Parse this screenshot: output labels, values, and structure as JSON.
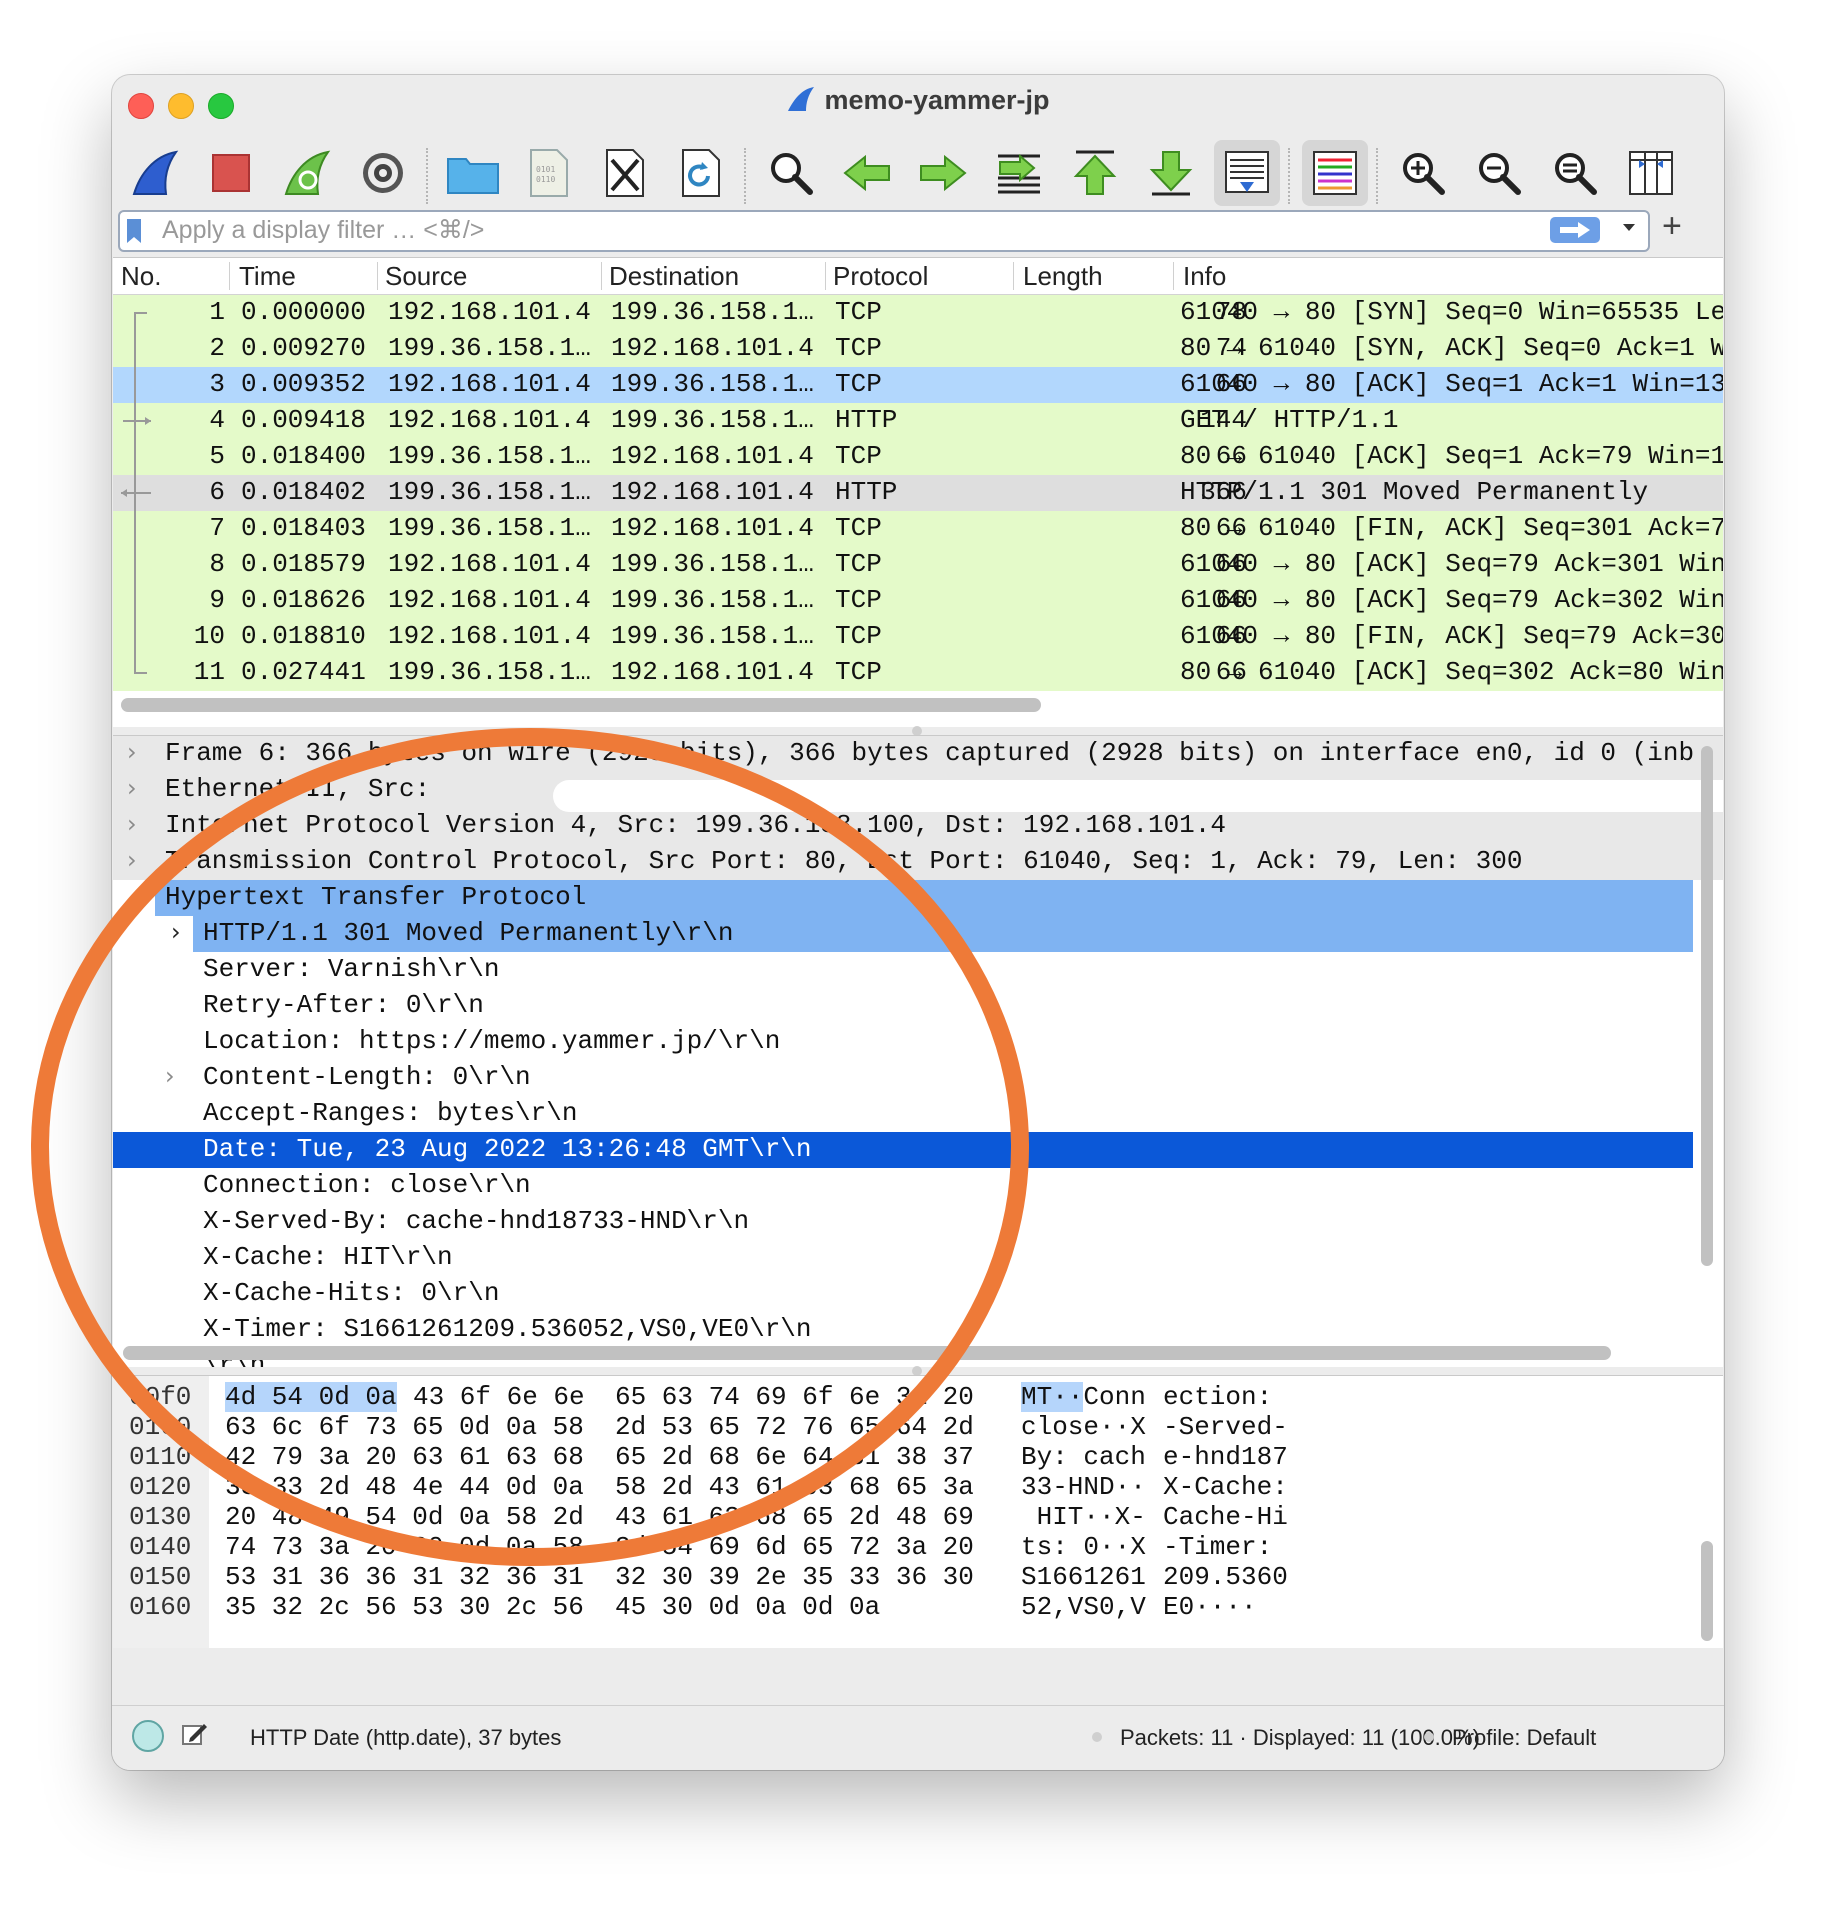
{
  "window": {
    "title": "memo-yammer-jp"
  },
  "toolbar": {
    "buttons": [
      {
        "name": "start-capture",
        "icon": "shark-fin-icon"
      },
      {
        "name": "stop-capture",
        "icon": "stop-icon"
      },
      {
        "name": "restart-capture",
        "icon": "restart-icon"
      },
      {
        "name": "capture-options",
        "icon": "gear-icon"
      },
      {
        "name": "open-file",
        "icon": "folder-icon"
      },
      {
        "name": "save-file",
        "icon": "file-icon"
      },
      {
        "name": "close-file",
        "icon": "close-file-icon"
      },
      {
        "name": "reload-file",
        "icon": "reload-icon"
      },
      {
        "name": "find-packet",
        "icon": "search-icon"
      },
      {
        "name": "go-back",
        "icon": "arrow-left-icon"
      },
      {
        "name": "go-forward",
        "icon": "arrow-right-icon"
      },
      {
        "name": "go-to-packet",
        "icon": "goto-icon"
      },
      {
        "name": "first-packet",
        "icon": "arrow-up-icon"
      },
      {
        "name": "last-packet",
        "icon": "arrow-down-icon"
      },
      {
        "name": "auto-scroll",
        "icon": "autoscroll-icon"
      },
      {
        "name": "colorize",
        "icon": "colorize-icon"
      },
      {
        "name": "zoom-in",
        "icon": "zoom-in-icon"
      },
      {
        "name": "zoom-out",
        "icon": "zoom-out-icon"
      },
      {
        "name": "normal-size",
        "icon": "zoom-reset-icon"
      },
      {
        "name": "resize-columns",
        "icon": "resize-columns-icon"
      }
    ]
  },
  "filter": {
    "placeholder": "Apply a display filter … <⌘/>",
    "add_label": "+"
  },
  "packet_list": {
    "columns": [
      "No.",
      "Time",
      "Source",
      "Destination",
      "Protocol",
      "Length",
      "Info"
    ],
    "rows": [
      {
        "no": "1",
        "time": "0.000000",
        "src": "192.168.101.4",
        "dst": "199.36.158.1…",
        "proto": "TCP",
        "len": "78",
        "info": "61040 → 80 [SYN] Seq=0 Win=65535 Le"
      },
      {
        "no": "2",
        "time": "0.009270",
        "src": "199.36.158.1…",
        "dst": "192.168.101.4",
        "proto": "TCP",
        "len": "74",
        "info": "80 → 61040 [SYN, ACK] Seq=0 Ack=1 W"
      },
      {
        "no": "3",
        "time": "0.009352",
        "src": "192.168.101.4",
        "dst": "199.36.158.1…",
        "proto": "TCP",
        "len": "66",
        "info": "61040 → 80 [ACK] Seq=1 Ack=1 Win=13"
      },
      {
        "no": "4",
        "time": "0.009418",
        "src": "192.168.101.4",
        "dst": "199.36.158.1…",
        "proto": "HTTP",
        "len": "144",
        "info": "GET / HTTP/1.1"
      },
      {
        "no": "5",
        "time": "0.018400",
        "src": "199.36.158.1…",
        "dst": "192.168.101.4",
        "proto": "TCP",
        "len": "66",
        "info": "80 → 61040 [ACK] Seq=1 Ack=79 Win=1"
      },
      {
        "no": "6",
        "time": "0.018402",
        "src": "199.36.158.1…",
        "dst": "192.168.101.4",
        "proto": "HTTP",
        "len": "366",
        "info": "HTTP/1.1 301 Moved Permanently"
      },
      {
        "no": "7",
        "time": "0.018403",
        "src": "199.36.158.1…",
        "dst": "192.168.101.4",
        "proto": "TCP",
        "len": "66",
        "info": "80 → 61040 [FIN, ACK] Seq=301 Ack=7"
      },
      {
        "no": "8",
        "time": "0.018579",
        "src": "192.168.101.4",
        "dst": "199.36.158.1…",
        "proto": "TCP",
        "len": "66",
        "info": "61040 → 80 [ACK] Seq=79 Ack=301 Win"
      },
      {
        "no": "9",
        "time": "0.018626",
        "src": "192.168.101.4",
        "dst": "199.36.158.1…",
        "proto": "TCP",
        "len": "66",
        "info": "61040 → 80 [ACK] Seq=79 Ack=302 Win"
      },
      {
        "no": "10",
        "time": "0.018810",
        "src": "192.168.101.4",
        "dst": "199.36.158.1…",
        "proto": "TCP",
        "len": "66",
        "info": "61040 → 80 [FIN, ACK] Seq=79 Ack=30"
      },
      {
        "no": "11",
        "time": "0.027441",
        "src": "199.36.158.1…",
        "dst": "192.168.101.4",
        "proto": "TCP",
        "len": "66",
        "info": "80 → 61040 [ACK] Seq=302 Ack=80 Win"
      }
    ]
  },
  "details": {
    "rows": [
      {
        "text": "Frame 6: 366 bytes on wire (2928 bits), 366 bytes captured (2928 bits) on interface en0, id 0 (inb",
        "expand": "›"
      },
      {
        "text": "Ethernet II, Src: ",
        "expand": "›"
      },
      {
        "text": "Internet Protocol Version 4, Src: 199.36.158.100, Dst: 192.168.101.4",
        "expand": "›"
      },
      {
        "text": "Transmission Control Protocol, Src Port: 80, Dst Port: 61040, Seq: 1, Ack: 79, Len: 300",
        "expand": "›"
      },
      {
        "text": "Hypertext Transfer Protocol",
        "expand": "⌄"
      },
      {
        "text": "HTTP/1.1 301 Moved Permanently\\r\\n",
        "expand": "›"
      },
      {
        "text": "Server: Varnish\\r\\n",
        "expand": ""
      },
      {
        "text": "Retry-After: 0\\r\\n",
        "expand": ""
      },
      {
        "text": "Location: https://memo.yammer.jp/\\r\\n",
        "expand": ""
      },
      {
        "text": "Content-Length: 0\\r\\n",
        "expand": "›"
      },
      {
        "text": "Accept-Ranges: bytes\\r\\n",
        "expand": ""
      },
      {
        "text": "Date: Tue, 23 Aug 2022 13:26:48 GMT\\r\\n",
        "expand": ""
      },
      {
        "text": "Connection: close\\r\\n",
        "expand": ""
      },
      {
        "text": "X-Served-By: cache-hnd18733-HND\\r\\n",
        "expand": ""
      },
      {
        "text": "X-Cache: HIT\\r\\n",
        "expand": ""
      },
      {
        "text": "X-Cache-Hits: 0\\r\\n",
        "expand": ""
      },
      {
        "text": "X-Timer: S1661261209.536052,VS0,VE0\\r\\n",
        "expand": ""
      },
      {
        "text": "\\r\\n",
        "expand": ""
      }
    ]
  },
  "bytes": {
    "rows": [
      {
        "off": "00f0",
        "hex1": "4d 54 0d 0a 43 6f 6e 6e",
        "hex2": "65 63 74 69 6f 6e 3a 20",
        "asc1": "MT··Conn",
        "asc2": "ection: "
      },
      {
        "off": "0100",
        "hex1": "63 6c 6f 73 65 0d 0a 58",
        "hex2": "2d 53 65 72 76 65 64 2d",
        "asc1": "close··X",
        "asc2": "-Served-"
      },
      {
        "off": "0110",
        "hex1": "42 79 3a 20 63 61 63 68",
        "hex2": "65 2d 68 6e 64 31 38 37",
        "asc1": "By: cach",
        "asc2": "e-hnd187"
      },
      {
        "off": "0120",
        "hex1": "33 33 2d 48 4e 44 0d 0a",
        "hex2": "58 2d 43 61 63 68 65 3a",
        "asc1": "33-HND··",
        "asc2": "X-Cache:"
      },
      {
        "off": "0130",
        "hex1": "20 48 49 54 0d 0a 58 2d",
        "hex2": "43 61 63 68 65 2d 48 69",
        "asc1": " HIT··X-",
        "asc2": "Cache-Hi"
      },
      {
        "off": "0140",
        "hex1": "74 73 3a 20 30 0d 0a 58",
        "hex2": "2d 54 69 6d 65 72 3a 20",
        "asc1": "ts: 0··X",
        "asc2": "-Timer: "
      },
      {
        "off": "0150",
        "hex1": "53 31 36 36 31 32 36 31",
        "hex2": "32 30 39 2e 35 33 36 30",
        "asc1": "S1661261",
        "asc2": "209.5360"
      },
      {
        "off": "0160",
        "hex1": "35 32 2c 56 53 30 2c 56",
        "hex2": "45 30 0d 0a 0d 0a",
        "asc1": "52,VS0,V",
        "asc2": "E0····"
      }
    ]
  },
  "status": {
    "field": "HTTP Date (http.date), 37 bytes",
    "packets": "Packets: 11 · Displayed: 11 (100.0%)",
    "profile": "Profile: Default"
  },
  "colors": {
    "tcp_row": "#e4fac9",
    "selected_row": "#b2d7fd",
    "annotation": "#ee7a38",
    "detail_selected": "#0b58d8"
  }
}
